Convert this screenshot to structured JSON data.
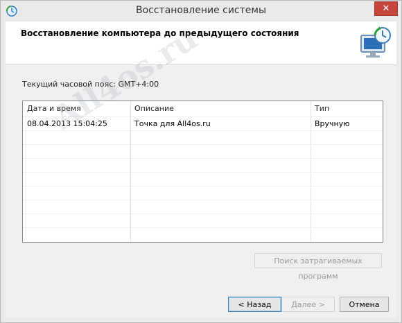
{
  "window": {
    "title": "Восстановление системы",
    "close_label": "✕"
  },
  "header": {
    "title": "Восстановление компьютера до предыдущего состояния"
  },
  "timezone_label": "Текущий часовой пояс: GMT+4:00",
  "table": {
    "columns": [
      "Дата и время",
      "Описание",
      "Тип"
    ],
    "rows": [
      {
        "datetime": "08.04.2013 15:04:25",
        "description": "Точка для All4os.ru",
        "type": "Вручную"
      }
    ]
  },
  "watermark": "All4os.ru",
  "buttons": {
    "scan_affected": "Поиск затрагиваемых программ",
    "back": "< Назад",
    "next": "Далее >",
    "cancel": "Отмена"
  },
  "icons": {
    "title": "system-restore-icon",
    "header": "system-restore-large-icon"
  }
}
